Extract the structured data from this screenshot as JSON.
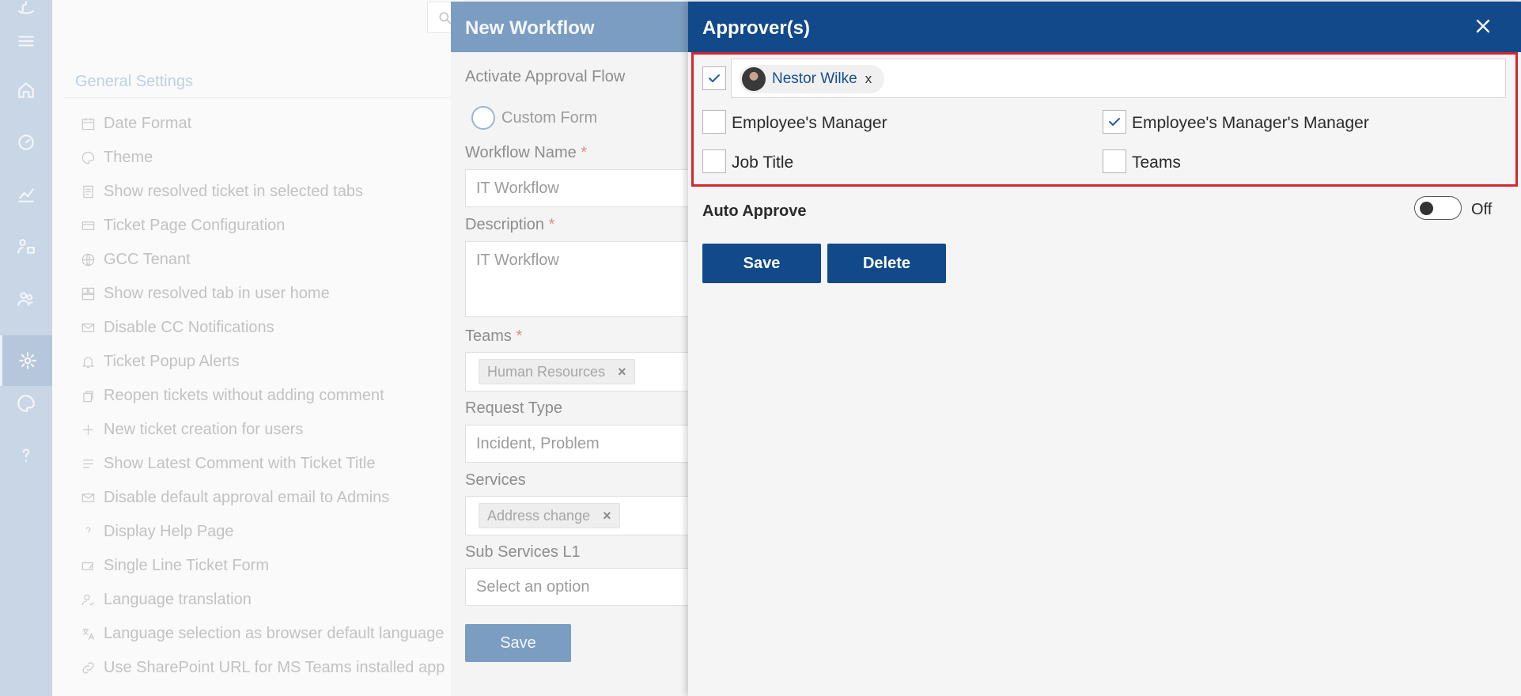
{
  "settings": {
    "title": "General Settings",
    "items": [
      {
        "label": "Date Format",
        "icon": "calendar-icon"
      },
      {
        "label": "Theme",
        "icon": "palette-icon"
      },
      {
        "label": "Show resolved ticket in selected tabs",
        "icon": "document-icon"
      },
      {
        "label": "Ticket Page Configuration",
        "icon": "window-icon"
      },
      {
        "label": "GCC Tenant",
        "icon": "globe-icon"
      },
      {
        "label": "Show resolved tab in user home",
        "icon": "layout-icon"
      },
      {
        "label": "Disable CC Notifications",
        "icon": "mail-icon"
      },
      {
        "label": "Ticket Popup Alerts",
        "icon": "bell-icon"
      },
      {
        "label": "Reopen tickets without adding comment",
        "icon": "reopen-icon"
      },
      {
        "label": "New ticket creation for users",
        "icon": "plus-icon"
      },
      {
        "label": "Show Latest Comment with Ticket Title",
        "icon": "lines-icon"
      },
      {
        "label": "Disable default approval email to Admins",
        "icon": "mail-icon"
      },
      {
        "label": "Display Help Page",
        "icon": "question-icon"
      },
      {
        "label": "Single Line Ticket Form",
        "icon": "form-icon"
      },
      {
        "label": "Language translation",
        "icon": "person-check-icon"
      },
      {
        "label": "Language selection as browser default language",
        "icon": "translate-icon"
      },
      {
        "label": "Use SharePoint URL for MS Teams installed app",
        "icon": "link-icon"
      }
    ]
  },
  "new_workflow": {
    "title": "New Workflow",
    "activate_label": "Activate Approval Flow",
    "custom_form_label": "Custom Form",
    "workflow_name_label": "Workflow Name",
    "workflow_name_value": "IT Workflow",
    "description_label": "Description",
    "description_value": "IT Workflow",
    "teams_label": "Teams",
    "teams_chip": "Human Resources",
    "request_type_label": "Request Type",
    "request_type_value": "Incident, Problem",
    "services_label": "Services",
    "services_chip": "Address change",
    "sub_services_label": "Sub Services L1",
    "sub_services_placeholder": "Select an option",
    "save_label": "Save",
    "required_mark": "*",
    "chip_remove": "×"
  },
  "approvers": {
    "title": "Approver(s)",
    "person": {
      "name": "Nestor Wilke",
      "remove": "x",
      "checked": true
    },
    "options": [
      {
        "label": "Employee's Manager",
        "checked": false
      },
      {
        "label": "Employee's Manager's Manager",
        "checked": true
      },
      {
        "label": "Job Title",
        "checked": false
      },
      {
        "label": "Teams",
        "checked": false
      }
    ],
    "auto_approve_label": "Auto Approve",
    "auto_approve_state": "Off",
    "save_label": "Save",
    "delete_label": "Delete"
  },
  "colors": {
    "header_blue": "#11498a",
    "dimmed_header": "#7b9dc2",
    "highlight_red": "#d9262c",
    "rail": "#c9d6e5"
  }
}
